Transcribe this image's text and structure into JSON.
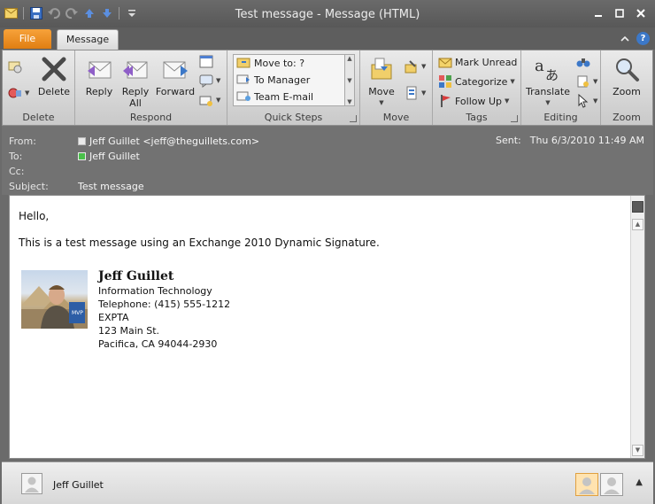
{
  "window": {
    "title": "Test message",
    "title_sep": " - ",
    "subtitle": "Message (HTML)"
  },
  "tabs": {
    "file": "File",
    "message": "Message"
  },
  "ribbon": {
    "groups": {
      "delete": {
        "label": "Delete",
        "delete_button": "Delete"
      },
      "respond": {
        "label": "Respond",
        "reply": "Reply",
        "reply_all_line1": "Reply",
        "reply_all_line2": "All",
        "forward": "Forward"
      },
      "quick_steps": {
        "label": "Quick Steps",
        "items": [
          "Move to: ?",
          "To Manager",
          "Team E-mail"
        ]
      },
      "move": {
        "label": "Move",
        "move_button": "Move"
      },
      "tags": {
        "label": "Tags",
        "mark_unread": "Mark Unread",
        "categorize": "Categorize",
        "follow_up": "Follow Up"
      },
      "editing": {
        "label": "Editing",
        "translate": "Translate"
      },
      "zoom": {
        "label": "Zoom",
        "zoom_button": "Zoom"
      }
    }
  },
  "header": {
    "from_label": "From:",
    "from_value": "Jeff Guillet <jeff@theguillets.com>",
    "to_label": "To:",
    "to_value": "Jeff Guillet",
    "cc_label": "Cc:",
    "subject_label": "Subject:",
    "subject_value": "Test message",
    "sent_label": "Sent:",
    "sent_value": "Thu 6/3/2010 11:49 AM"
  },
  "body": {
    "greeting": "Hello,",
    "line1": "This is a test message using an Exchange 2010 Dynamic Signature.",
    "signature": {
      "name": "Jeff Guillet",
      "department": "Information Technology",
      "telephone": "Telephone: (415) 555-1212",
      "company": "EXPTA",
      "street": "123 Main St.",
      "city": "Pacifica, CA 94044-2930"
    }
  },
  "people_pane": {
    "name": "Jeff Guillet"
  },
  "colors": {
    "file_tab": "#e8871c",
    "presence_online": "#49c04a",
    "accent_blue": "#3c78c8"
  }
}
